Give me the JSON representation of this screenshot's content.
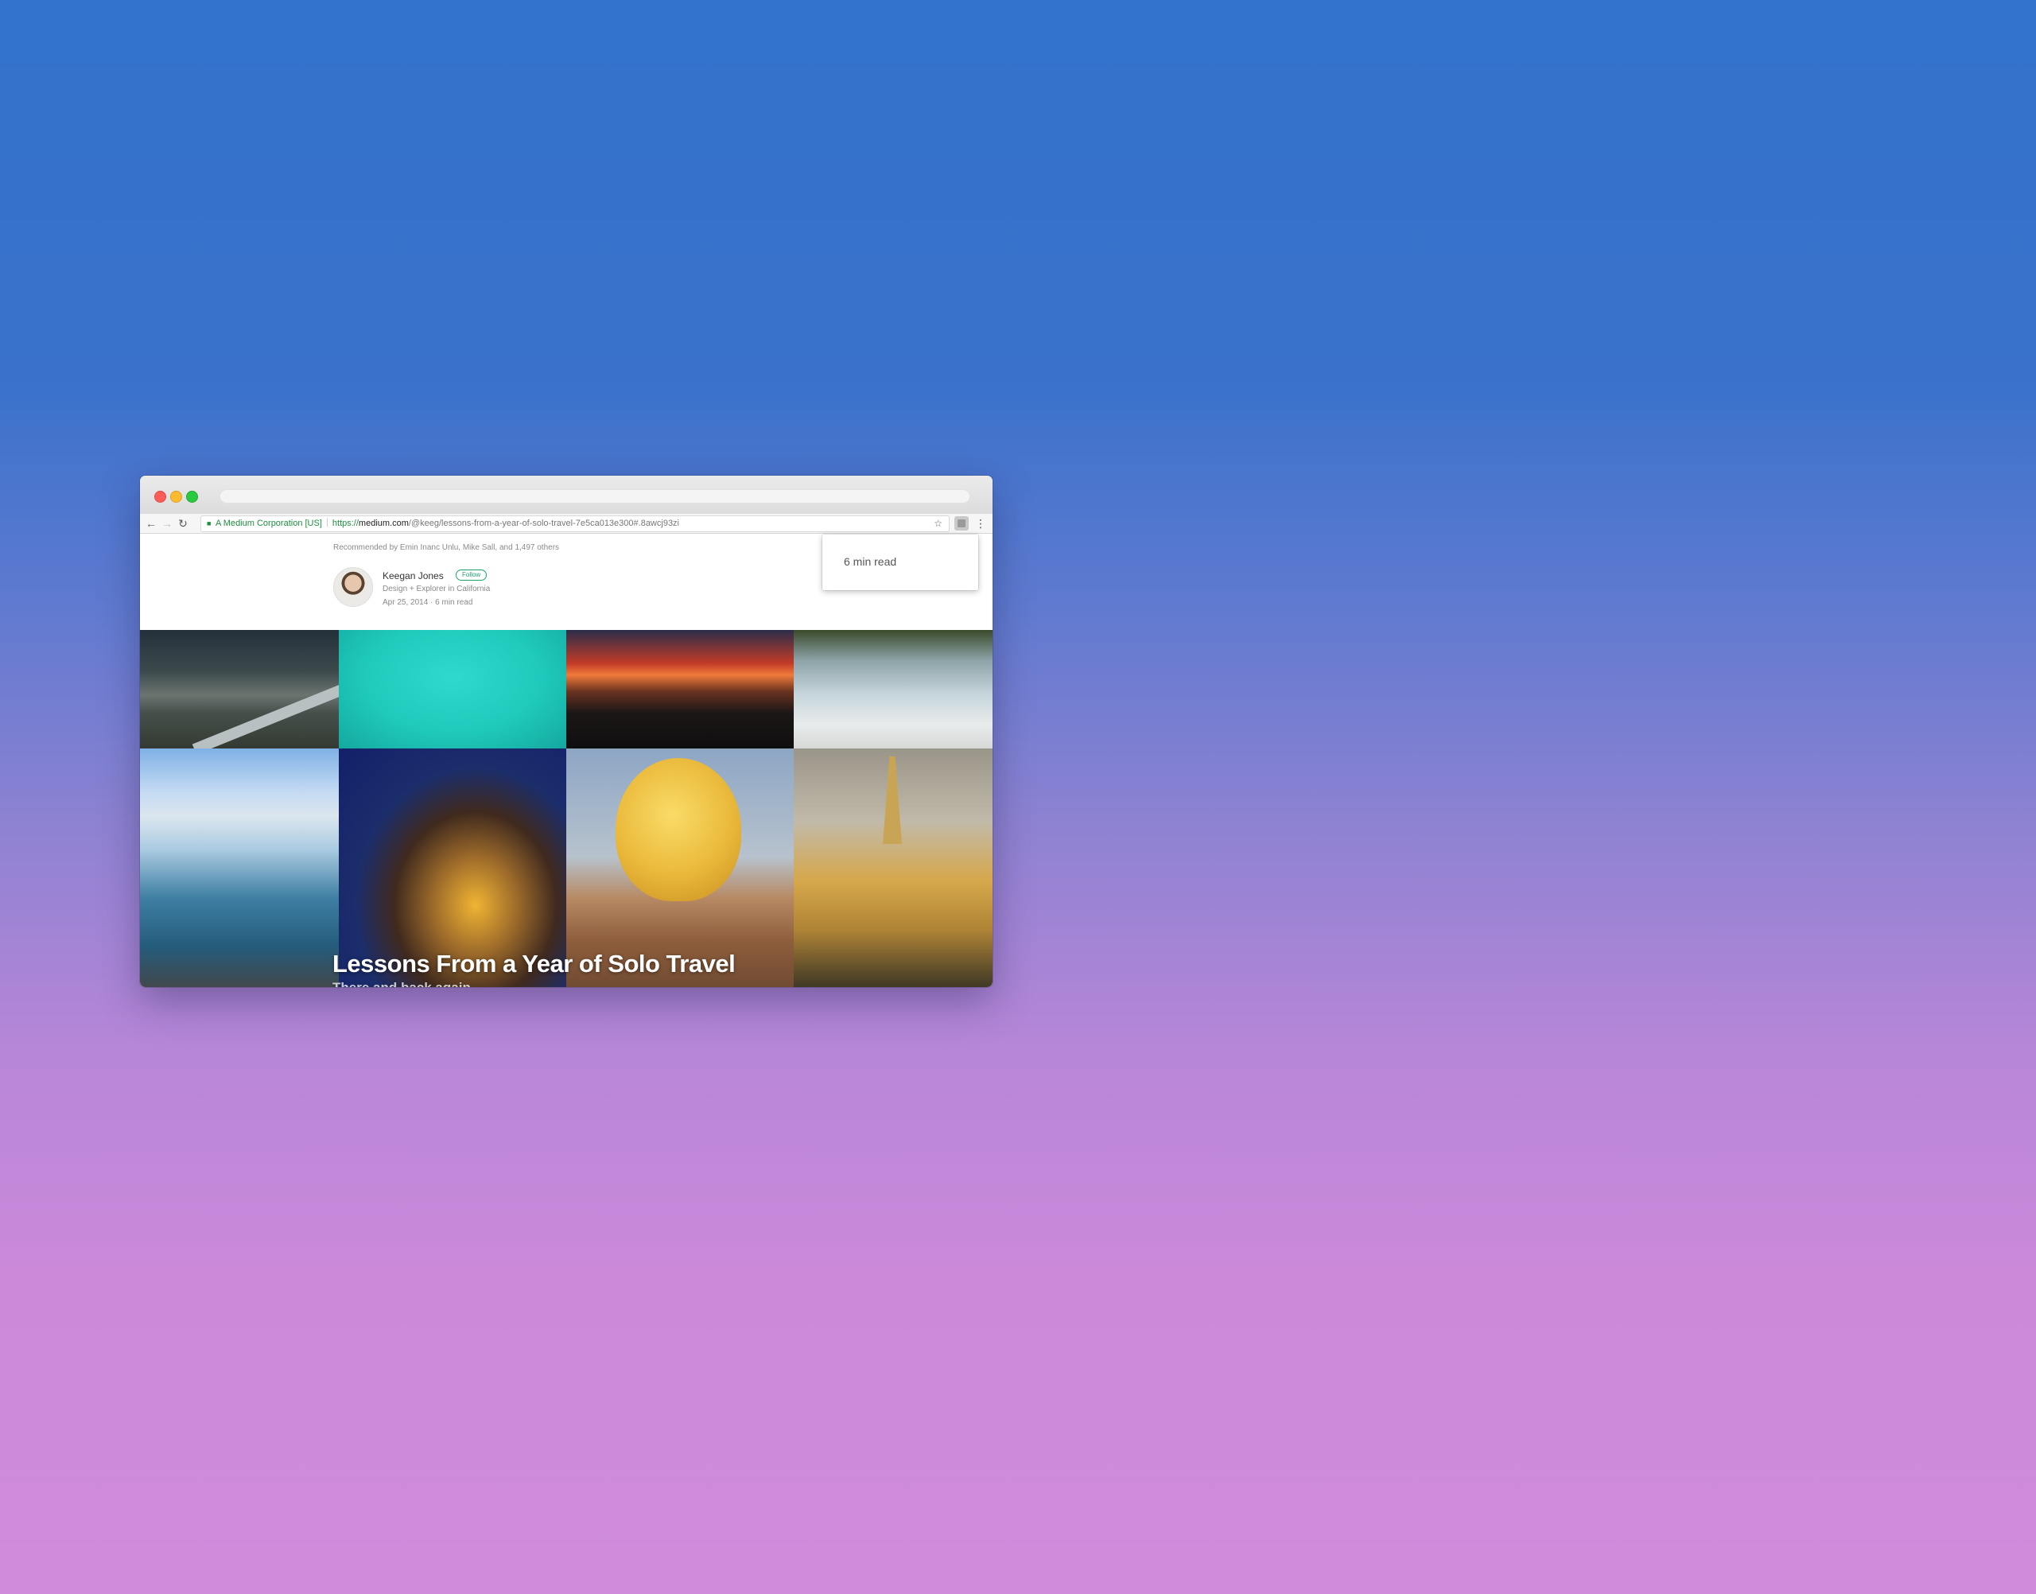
{
  "browser": {
    "security_label": "A Medium Corporation [US]",
    "url": {
      "scheme": "https://",
      "domain": "medium.com",
      "path": "/@keeg/lessons-from-a-year-of-solo-travel-7e5ca013e300#.8awcj93zi"
    },
    "icons": {
      "back": "←",
      "forward": "→",
      "reload": "↻",
      "lock": "🔒",
      "star": "☆",
      "menu": "⋮"
    }
  },
  "popup": {
    "text": "6 min read"
  },
  "article": {
    "recommended": "Recommended by Emin Inanc Unlu, Mike Sall, and 1,497 others",
    "author": {
      "name": "Keegan Jones",
      "follow_label": "Follow",
      "bio": "Design + Explorer in California"
    },
    "meta": "Apr 25, 2014 · 6 min read",
    "title": "Lessons From a Year of Solo Travel",
    "subtitle": "There and back again."
  },
  "colors": {
    "accent": "#1ca56b",
    "secure": "#1d8f3f"
  }
}
